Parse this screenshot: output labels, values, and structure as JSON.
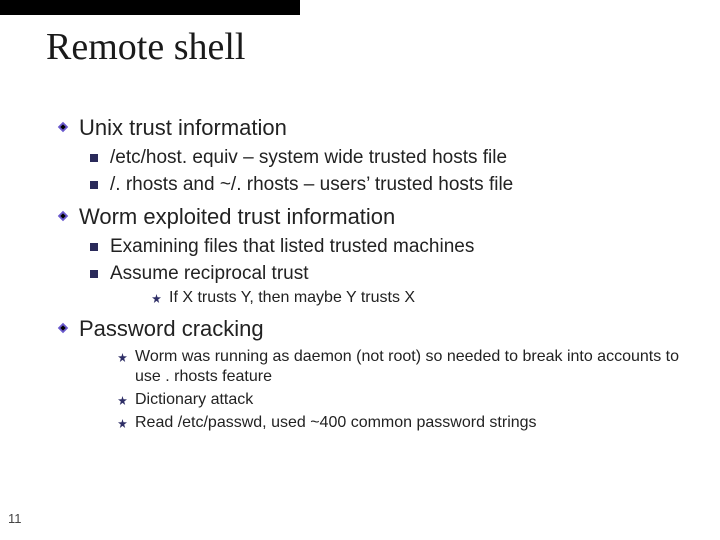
{
  "title": "Remote shell",
  "page_number": "11",
  "sections": [
    {
      "heading": "Unix trust information",
      "sub": [
        {
          "text": "/etc/host. equiv – system wide trusted hosts file"
        },
        {
          "text": "/. rhosts and ~/. rhosts – users’ trusted hosts file"
        }
      ]
    },
    {
      "heading": "Worm exploited trust information",
      "sub": [
        {
          "text": "Examining files that listed trusted machines"
        },
        {
          "text": "Assume reciprocal trust",
          "subsub": [
            {
              "text": "If X trusts Y, then maybe Y trusts X"
            }
          ]
        }
      ]
    },
    {
      "heading": "Password cracking",
      "direct_subsub": [
        {
          "text": "Worm was running as daemon (not root) so needed to break into accounts to use . rhosts feature"
        },
        {
          "text": "Dictionary attack"
        },
        {
          "text": "Read /etc/passwd, used ~400 common password strings"
        }
      ]
    }
  ]
}
